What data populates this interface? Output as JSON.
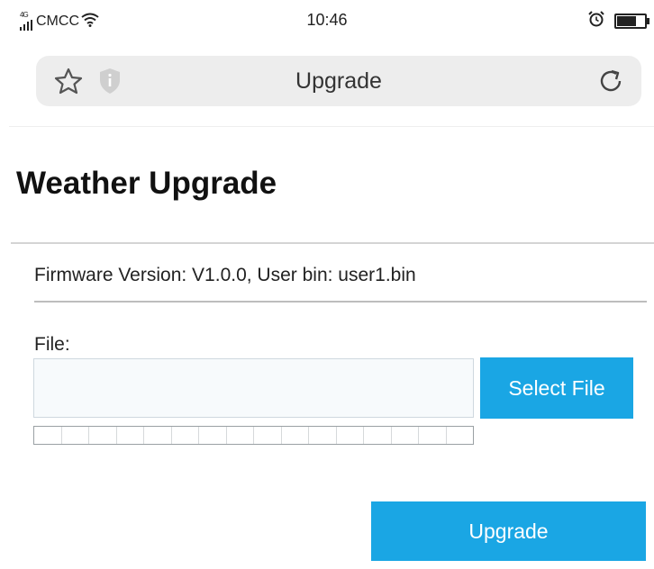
{
  "status_bar": {
    "network": "4G",
    "carrier": "CMCC",
    "time": "10:46",
    "battery_level": 0.8
  },
  "browser": {
    "title": "Upgrade"
  },
  "page": {
    "heading": "Weather Upgrade",
    "firmware_info": "Firmware Version: V1.0.0, User bin: user1.bin",
    "file_label": "File:",
    "file_value": "",
    "select_file_label": "Select File",
    "progress": 0,
    "upgrade_label": "Upgrade"
  },
  "colors": {
    "accent": "#1aa6e4",
    "url_bar_bg": "#ededed"
  },
  "icons": [
    "star-icon",
    "shield-info-icon",
    "reload-icon",
    "signal-icon",
    "wifi-icon",
    "alarm-icon",
    "battery-icon"
  ]
}
